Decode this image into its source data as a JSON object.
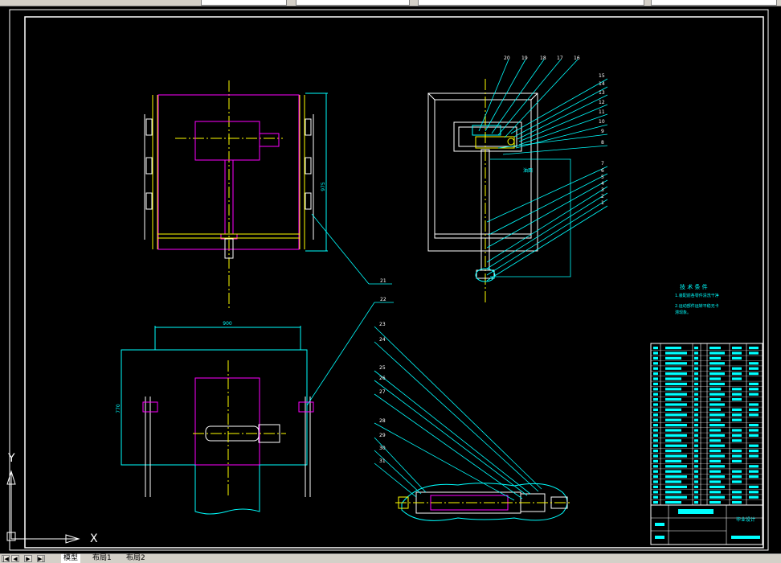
{
  "tabs": [
    {
      "label": "模型",
      "active": true
    },
    {
      "label": "布局1",
      "active": false
    },
    {
      "label": "布局2",
      "active": false
    }
  ],
  "ucs": {
    "x_label": "X",
    "y_label": "Y"
  },
  "dimensions": {
    "top_height": "975",
    "bottom_width": "900",
    "bottom_height": "770"
  },
  "section_note": "油面",
  "tech_requirements": {
    "title": "技 术 条 件",
    "lines": [
      "1.装配前各零件清洗干净",
      "2.运动部件运转平稳无卡",
      "滞现象。"
    ]
  },
  "title_block": {
    "name": "毕业设计"
  },
  "callouts_top_right": [
    "20",
    "19",
    "18",
    "17",
    "16"
  ],
  "callouts_right": [
    "15",
    "14",
    "13",
    "12",
    "11",
    "10",
    "9",
    "8",
    "7",
    "6",
    "5",
    "4",
    "3",
    "2",
    "1"
  ],
  "callouts_mid": [
    "21",
    "22"
  ],
  "callouts_bottom_right": [
    "23",
    "24",
    "25",
    "26",
    "27",
    "28",
    "29",
    "30",
    "31"
  ],
  "colors": {
    "cyan": "#00ffff",
    "yellow": "#ffff00",
    "magenta": "#ff00ff",
    "white": "#ffffff",
    "background": "#000000"
  }
}
